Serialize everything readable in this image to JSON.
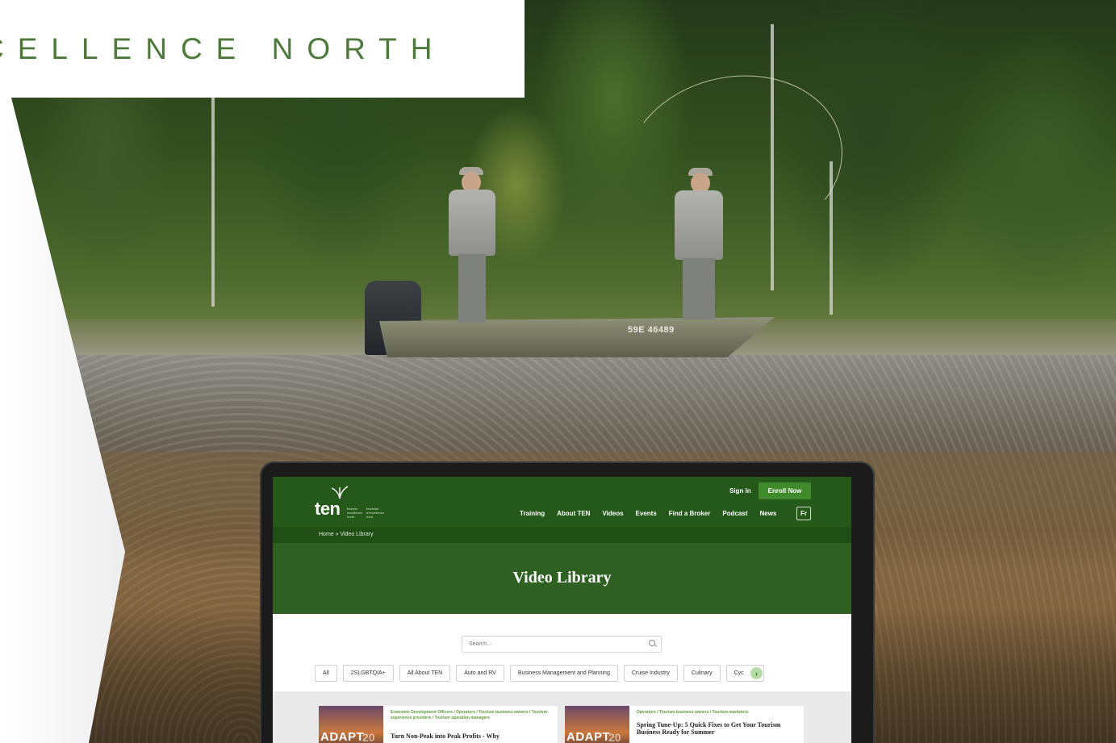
{
  "banner": {
    "title": "CELLENCE NORTH",
    "boat_id": "59E 46489"
  },
  "site": {
    "logo": {
      "text": "ten",
      "tagline_en": "tourism excellence north",
      "tagline_fr": "tourisme d'excellence nord"
    },
    "header": {
      "sign_in": "Sign In",
      "enroll": "Enroll Now",
      "lang": "Fr"
    },
    "nav": [
      "Training",
      "About TEN",
      "Videos",
      "Events",
      "Find a Broker",
      "Podcast",
      "News"
    ],
    "breadcrumb": "Home » Video Library",
    "page_title": "Video Library",
    "search": {
      "placeholder": "Search..."
    },
    "filters": [
      "All",
      "2SLGBTQIA+",
      "All About TEN",
      "Auto and RV",
      "Business Management and Planning",
      "Cruise Industry",
      "Culinary",
      "Cyc"
    ],
    "cards": [
      {
        "thumb_text": "ADAPT",
        "thumb_year": "20",
        "tags": "Economic Development Officers / Operators / Tourism business owners / Tourism experience providers / Tourism operation managers",
        "title": "Turn Non-Peak into Peak Profits - Why"
      },
      {
        "thumb_text": "ADAPT",
        "thumb_year": "20",
        "tags": "Operators / Tourism business owners / Tourism marketers",
        "title": "Spring Tune-Up: 5 Quick Fixes to Get Your Tourism Business Ready for Summer"
      }
    ]
  },
  "colors": {
    "brand_green": "#24591a",
    "hero_green": "#2d6021",
    "accent_green": "#3f8b2c",
    "title_green": "#4d7a3a"
  }
}
